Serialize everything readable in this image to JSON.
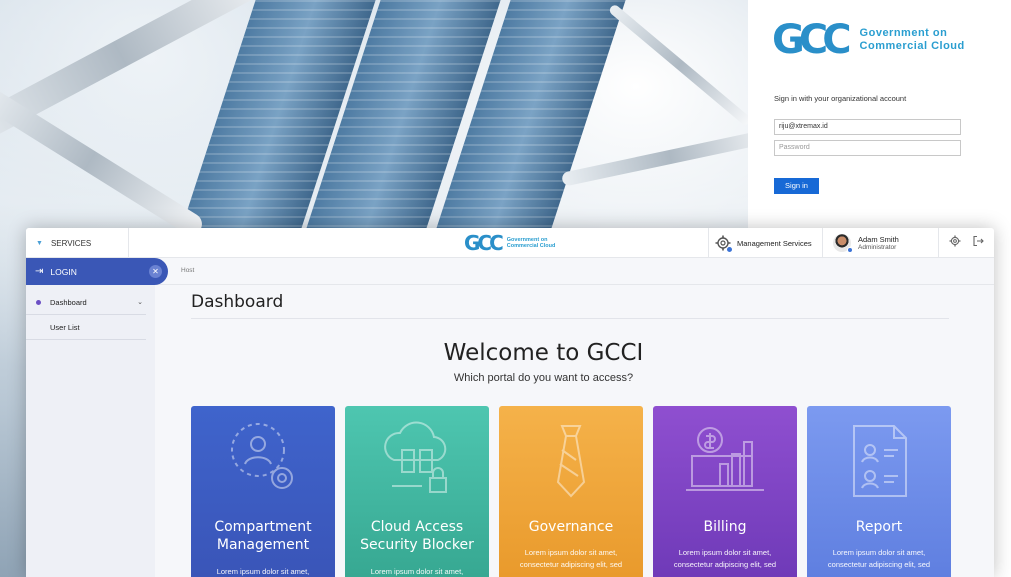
{
  "login": {
    "brand_line1": "Government on",
    "brand_line2": "Commercial Cloud",
    "logo_mark": "GCC",
    "prompt": "Sign in with your organizational account",
    "email_value": "riju@xtremax.id",
    "password_placeholder": "Password",
    "signin_label": "Sign in"
  },
  "topbar": {
    "services_label": "SERVICES",
    "logo_mark": "GCC",
    "logo_line1": "Government on",
    "logo_line2": "Commercial Cloud",
    "management_label": "Management Services",
    "user_name": "Adam Smith",
    "user_role": "Administrator"
  },
  "sidebar": {
    "login_label": "LOGIN",
    "items": [
      {
        "label": "Dashboard"
      },
      {
        "label": "User List"
      }
    ]
  },
  "breadcrumb": "Host",
  "page_title": "Dashboard",
  "welcome_title": "Welcome to GCCI",
  "welcome_question": "Which portal do you want to access?",
  "cards": [
    {
      "line1": "Compartment",
      "line2": "Management",
      "desc1": "Lorem ipsum dolor sit amet,",
      "desc2": "",
      "icon": "user-settings-icon",
      "color_top": "#3f64cc",
      "color_bottom": "#3a55b8"
    },
    {
      "line1": "Cloud Access",
      "line2": "Security Blocker",
      "desc1": "Lorem ipsum dolor sit amet,",
      "desc2": "",
      "icon": "cloud-lock-icon",
      "color_top": "#4ec6b0",
      "color_bottom": "#37a892"
    },
    {
      "line1": "Governance",
      "line2": "",
      "desc1": "Lorem ipsum dolor sit amet,",
      "desc2": "consectetur adipiscing elit, sed",
      "icon": "tie-icon",
      "color_top": "#f5b24a",
      "color_bottom": "#e99a2c"
    },
    {
      "line1": "Billing",
      "line2": "",
      "desc1": "Lorem ipsum dolor sit amet,",
      "desc2": "consectetur adipiscing elit, sed",
      "icon": "billing-chart-icon",
      "color_top": "#8f4fd0",
      "color_bottom": "#6f3ab8"
    },
    {
      "line1": "Report",
      "line2": "",
      "desc1": "Lorem ipsum dolor sit amet,",
      "desc2": "consectetur adipiscing elit, sed",
      "icon": "report-icon",
      "color_top": "#7c9af0",
      "color_bottom": "#5f7fe0"
    }
  ]
}
